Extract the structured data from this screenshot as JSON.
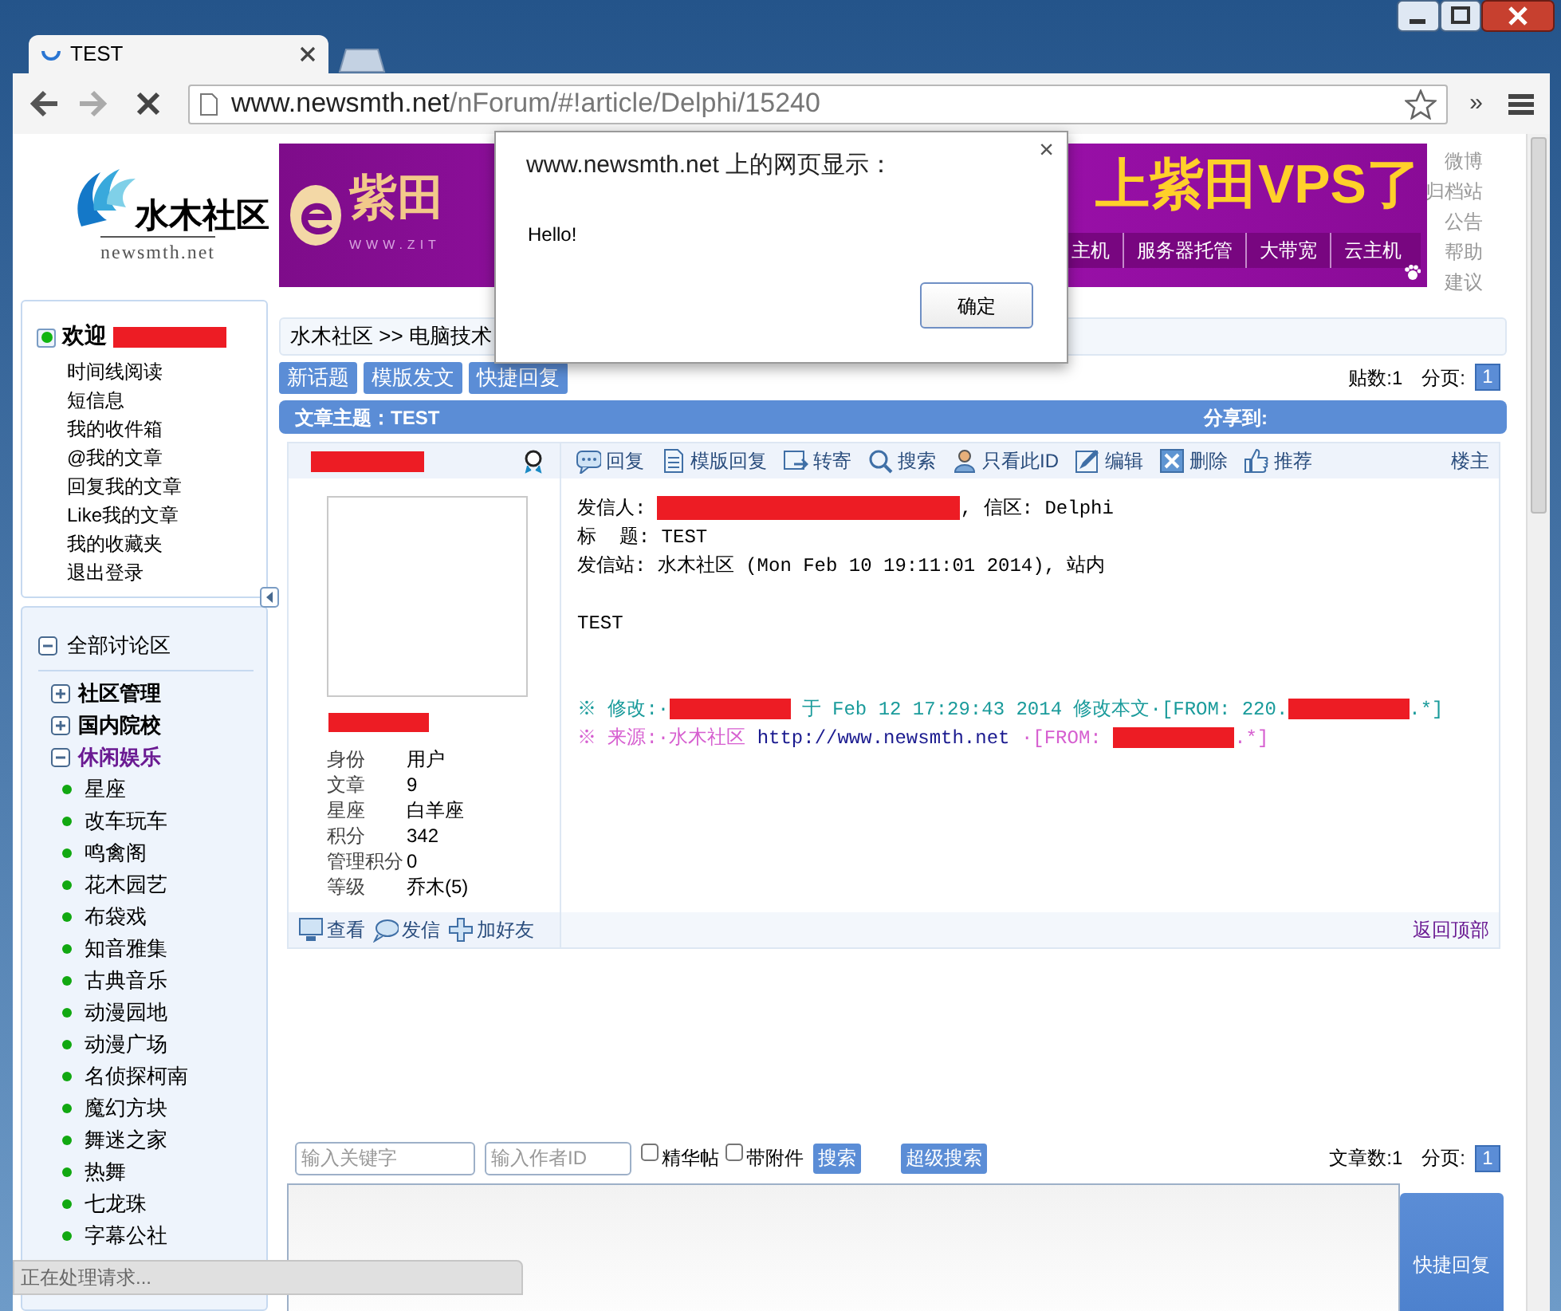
{
  "browser": {
    "tabs": [
      {
        "title": "TEST",
        "selected": true
      }
    ],
    "url_host": "www.newsmth.net",
    "url_path": "/nForum/#!article/Delphi/15240",
    "overflow": "»"
  },
  "header": {
    "logo_text": "水木社区",
    "logo_domain": "newsmth.net",
    "banner_brand": "紫田",
    "banner_url": "WWW.ZIT",
    "banner_slogan": "上紫田VPS了",
    "banner_links": [
      "主机",
      "服务器托管",
      "大带宽",
      "云主机"
    ],
    "side_links": [
      "微博",
      "归档站",
      "公告",
      "帮助",
      "建议"
    ]
  },
  "dialog": {
    "title": "www.newsmth.net 上的网页显示：",
    "close": "×",
    "message": "Hello!",
    "button": "确定"
  },
  "user_box": {
    "welcome": "欢迎",
    "online": true,
    "links": [
      "时间线阅读",
      "短信息",
      "我的收件箱",
      "@我的文章",
      "回复我的文章",
      "Like我的文章",
      "我的收藏夹",
      "退出登录"
    ]
  },
  "board_tree": {
    "root": "全部讨论区",
    "expanded": true,
    "sections": [
      {
        "label": "社区管理",
        "expanded": false
      },
      {
        "label": "国内院校",
        "expanded": false
      },
      {
        "label": "休闲娱乐",
        "expanded": true,
        "children": [
          "星座",
          "改车玩车",
          "鸣禽阁",
          "花木园艺",
          "布袋戏",
          "知音雅集",
          "古典音乐",
          "动漫园地",
          "动漫广场",
          "名侦探柯南",
          "魔幻方块",
          "舞迷之家",
          "热舞",
          "七龙珠",
          "字幕公社"
        ]
      }
    ]
  },
  "breadcrumb": "水木社区 >> 电脑技术",
  "actions": [
    "新话题",
    "模版发文",
    "快捷回复"
  ],
  "post_count": "贴数:1",
  "pager_label": "分页:",
  "pages": [
    {
      "label": "1",
      "selected": true
    }
  ],
  "topic": "文章主题：TEST",
  "share": "分享到:",
  "post": {
    "author_stats": [
      {
        "label": "身份",
        "value": "用户"
      },
      {
        "label": "文章",
        "value": "9"
      },
      {
        "label": "星座",
        "value": "白羊座"
      },
      {
        "label": "积分",
        "value": "342"
      },
      {
        "label": "管理积分",
        "value": "0"
      },
      {
        "label": "等级",
        "value": "乔木(5)"
      }
    ],
    "user_actions": [
      "查看",
      "发信",
      "加好友"
    ],
    "toolbar": [
      "回复",
      "模版回复",
      "转寄",
      "搜索",
      "只看此ID",
      "编辑",
      "删除",
      "推荐"
    ],
    "floor": "楼主",
    "lines": [
      {
        "kind": "plain",
        "segments": [
          {
            "kind": "text",
            "text": "发信人: "
          },
          {
            "kind": "redaction"
          },
          {
            "kind": "text",
            "text": ", 信区: Delphi"
          }
        ]
      },
      {
        "kind": "plain",
        "segments": [
          {
            "kind": "text",
            "text": "标  题: TEST"
          }
        ]
      },
      {
        "kind": "plain",
        "segments": [
          {
            "kind": "text",
            "text": "发信站: 水木社区 (Mon Feb 10 19:11:01 2014), 站内"
          }
        ]
      },
      {
        "kind": "blank"
      },
      {
        "kind": "plain",
        "segments": [
          {
            "kind": "text",
            "text": "TEST"
          }
        ]
      },
      {
        "kind": "blank"
      },
      {
        "kind": "blank"
      },
      {
        "kind": "modify",
        "segments": [
          {
            "kind": "text",
            "text": "※ 修改:·"
          },
          {
            "kind": "redaction"
          },
          {
            "kind": "text",
            "text": " 于 Feb 12 17:29:43 2014 修改本文·[FROM: 220."
          },
          {
            "kind": "redaction"
          },
          {
            "kind": "text",
            "text": ".*]"
          }
        ]
      },
      {
        "kind": "source",
        "segments": [
          {
            "kind": "text",
            "text": "※ 来源:·水木社区 "
          },
          {
            "kind": "link",
            "text": "http://www.newsmth.net"
          },
          {
            "kind": "text",
            "text": " ·[FROM: "
          },
          {
            "kind": "redaction"
          },
          {
            "kind": "text",
            "text": ".*]"
          }
        ]
      }
    ],
    "back_to_top": "返回顶部"
  },
  "search": {
    "keyword_placeholder": "输入关键字",
    "author_placeholder": "输入作者ID",
    "filters": [
      {
        "label": "精华帖",
        "checked": false
      },
      {
        "label": "带附件",
        "checked": false
      }
    ],
    "button": "搜索",
    "advanced": "超级搜索",
    "article_count": "文章数:1",
    "pager_label": "分页:",
    "pages": [
      {
        "label": "1",
        "selected": true
      }
    ]
  },
  "quick_reply": {
    "button": "快捷回复"
  },
  "status_bar": "正在处理请求..."
}
